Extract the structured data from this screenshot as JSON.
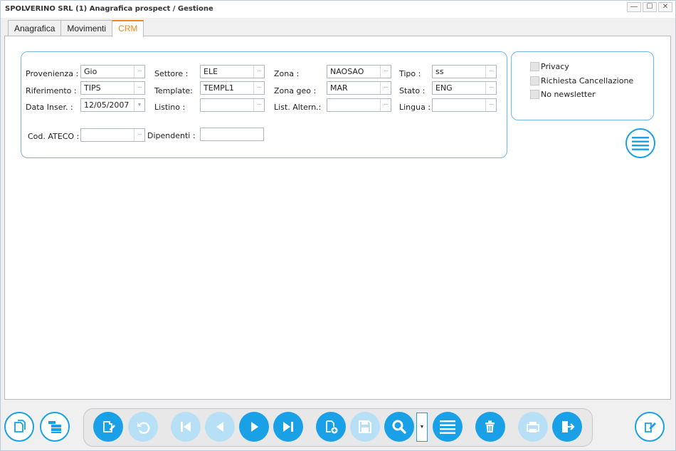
{
  "window": {
    "title": "SPOLVERINO SRL (1) Anagrafica prospect / Gestione",
    "controls": {
      "minimize": "—",
      "maximize": "☐",
      "close": "✕"
    }
  },
  "tabs": [
    {
      "label": "Anagrafica"
    },
    {
      "label": "Movimenti"
    },
    {
      "label": "CRM"
    }
  ],
  "form": {
    "provenienza": {
      "label": "Provenienza :",
      "value": "Gio"
    },
    "riferimento": {
      "label": "Riferimento :",
      "value": "TIPS"
    },
    "data_inser": {
      "label": "Data Inser. :",
      "value": "12/05/2007"
    },
    "cod_ateco": {
      "label": "Cod. ATECO :",
      "value": ""
    },
    "settore": {
      "label": "Settore :",
      "value": "ELE"
    },
    "template": {
      "label": "Template:",
      "value": "TEMPL1"
    },
    "listino": {
      "label": "Listino :",
      "value": ""
    },
    "dipendenti": {
      "label": "Dipendenti :",
      "value": ""
    },
    "zona": {
      "label": "Zona :",
      "value": "NAOSAO"
    },
    "zona_geo": {
      "label": "Zona geo :",
      "value": "MAR"
    },
    "list_altern": {
      "label": "List. Altern.:",
      "value": ""
    },
    "tipo": {
      "label": "Tipo :",
      "value": "ss"
    },
    "stato": {
      "label": "Stato :",
      "value": "ENG"
    },
    "lingua": {
      "label": "Lingua :",
      "value": ""
    },
    "lookup_glyph": "···",
    "dropdown_glyph": "▼"
  },
  "options": {
    "privacy": {
      "label": "Privacy"
    },
    "richiesta_cancellazione": {
      "label": "Richiesta Cancellazione"
    },
    "no_newsletter": {
      "label": "No newsletter"
    }
  },
  "search_dropdown_glyph": "▼",
  "colors": {
    "accent": "#1aa0e6",
    "accent_disabled": "#b7e0f6",
    "active_tab": "#f08a1c",
    "panel_border": "#6fb5e8"
  }
}
